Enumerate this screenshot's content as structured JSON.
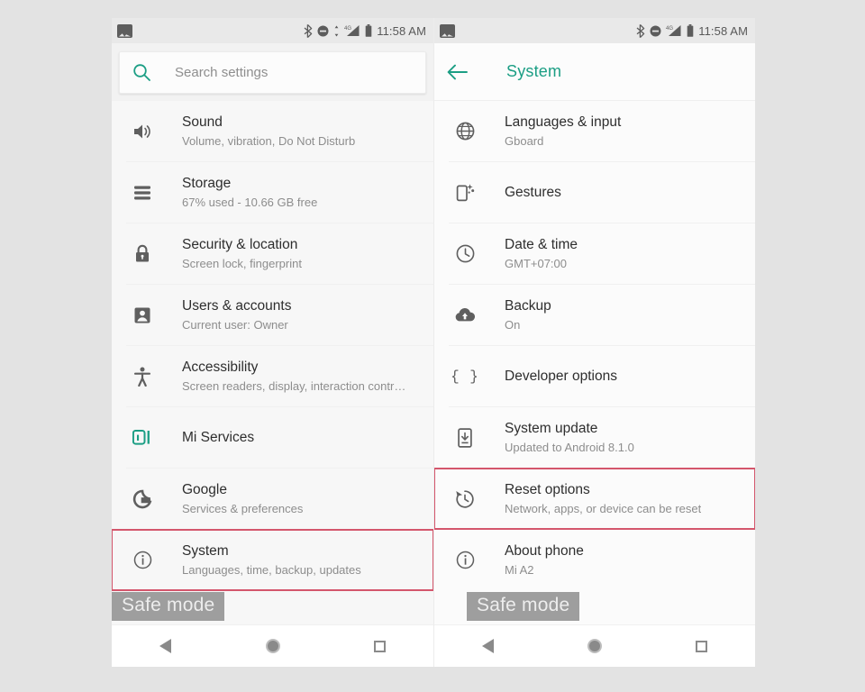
{
  "page": {
    "background_color": "#e3e3e3",
    "accent_color": "#1b9e84",
    "highlight_color": "#d4566c"
  },
  "left_phone": {
    "status_bar": {
      "notification_icon": "screenshot-image-icon",
      "icons": [
        "bluetooth-icon",
        "do-not-disturb-icon",
        "mobile-data-arrows-icon",
        "signal-4g-icon",
        "battery-icon"
      ],
      "time": "11:58 AM"
    },
    "search": {
      "icon": "search-icon",
      "placeholder": "Search settings",
      "value": ""
    },
    "safe_mode_badge": "Safe mode",
    "items": [
      {
        "icon": "volume-speaker-icon",
        "title": "Sound",
        "subtitle": "Volume, vibration, Do Not Disturb",
        "highlighted": false
      },
      {
        "icon": "storage-stack-icon",
        "title": "Storage",
        "subtitle": "67% used - 10.66 GB free",
        "highlighted": false
      },
      {
        "icon": "lock-icon",
        "title": "Security & location",
        "subtitle": "Screen lock, fingerprint",
        "highlighted": false
      },
      {
        "icon": "account-person-icon",
        "title": "Users & accounts",
        "subtitle": "Current user: Owner",
        "highlighted": false
      },
      {
        "icon": "accessibility-icon",
        "title": "Accessibility",
        "subtitle": "Screen readers, display, interaction contr…",
        "highlighted": false
      },
      {
        "icon": "mi-logo-icon",
        "title": "Mi Services",
        "subtitle": "",
        "highlighted": false
      },
      {
        "icon": "google-g-icon",
        "title": "Google",
        "subtitle": "Services & preferences",
        "highlighted": false
      },
      {
        "icon": "info-circle-icon",
        "title": "System",
        "subtitle": "Languages, time, backup, updates",
        "highlighted": true
      }
    ],
    "nav_bar": [
      "back-nav-icon",
      "home-nav-icon",
      "recents-nav-icon"
    ]
  },
  "right_phone": {
    "status_bar": {
      "notification_icon": "screenshot-image-icon",
      "icons": [
        "bluetooth-icon",
        "do-not-disturb-icon",
        "signal-4g-icon",
        "battery-icon"
      ],
      "time": "11:58 AM"
    },
    "toolbar": {
      "back_icon": "back-arrow-icon",
      "title": "System"
    },
    "safe_mode_badge": "Safe mode",
    "items": [
      {
        "icon": "globe-icon",
        "title": "Languages & input",
        "subtitle": "Gboard",
        "highlighted": false
      },
      {
        "icon": "gestures-phone-icon",
        "title": "Gestures",
        "subtitle": "",
        "highlighted": false
      },
      {
        "icon": "clock-icon",
        "title": "Date & time",
        "subtitle": "GMT+07:00",
        "highlighted": false
      },
      {
        "icon": "cloud-upload-icon",
        "title": "Backup",
        "subtitle": "On",
        "highlighted": false
      },
      {
        "icon": "curly-braces-icon",
        "title": "Developer options",
        "subtitle": "",
        "highlighted": false
      },
      {
        "icon": "system-update-icon",
        "title": "System update",
        "subtitle": "Updated to Android 8.1.0",
        "highlighted": false
      },
      {
        "icon": "reset-history-icon",
        "title": "Reset options",
        "subtitle": "Network, apps, or device can be reset",
        "highlighted": true
      },
      {
        "icon": "info-circle-icon",
        "title": "About phone",
        "subtitle": "Mi A2",
        "highlighted": false
      }
    ],
    "nav_bar": [
      "back-nav-icon",
      "home-nav-icon",
      "recents-nav-icon"
    ]
  }
}
